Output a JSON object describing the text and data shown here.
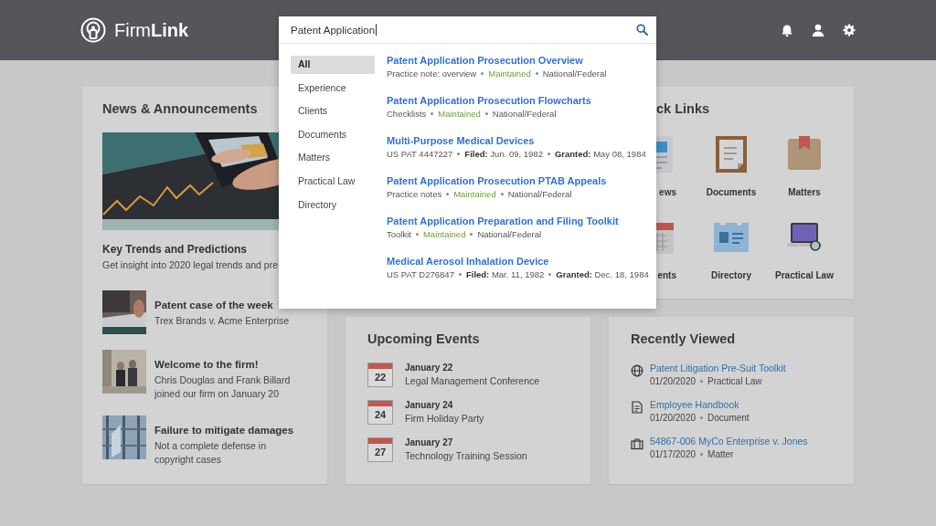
{
  "header": {
    "logo": "Firm**Link**"
  },
  "search": {
    "value": "Patent Application",
    "categories": [
      {
        "label": "All",
        "selected": true
      },
      {
        "label": "Experience",
        "selected": false
      },
      {
        "label": "Clients",
        "selected": false
      },
      {
        "label": "Documents",
        "selected": false
      },
      {
        "label": "Matters",
        "selected": false
      },
      {
        "label": "Practical Law",
        "selected": false
      },
      {
        "label": "Directory",
        "selected": false
      }
    ],
    "results": [
      {
        "title": "Patent Application Prosecution Overview",
        "meta": [
          {
            "kind": "text",
            "text": "Practice note: overview"
          },
          {
            "kind": "status",
            "text": "Maintained"
          },
          {
            "kind": "text",
            "text": "National/Federal"
          }
        ]
      },
      {
        "title": "Patent Application Prosecution Flowcharts",
        "meta": [
          {
            "kind": "text",
            "text": "Checklists"
          },
          {
            "kind": "status",
            "text": "Maintained"
          },
          {
            "kind": "text",
            "text": "National/Federal"
          }
        ]
      },
      {
        "title": "Multi-Purpose Medical Devices",
        "meta": [
          {
            "kind": "text",
            "text": "US PAT 4447227"
          },
          {
            "kind": "field",
            "label": "Filed:",
            "text": "Jun. 09, 1982"
          },
          {
            "kind": "field",
            "label": "Granted:",
            "text": "May 08, 1984"
          }
        ]
      },
      {
        "title": "Patent Application Prosecution PTAB Appeals",
        "meta": [
          {
            "kind": "text",
            "text": "Practice notes"
          },
          {
            "kind": "status",
            "text": "Maintained"
          },
          {
            "kind": "text",
            "text": "National/Federal"
          }
        ]
      },
      {
        "title": "Patent Application Preparation and Filing Toolkit",
        "meta": [
          {
            "kind": "text",
            "text": "Toolkit"
          },
          {
            "kind": "status",
            "text": "Maintained"
          },
          {
            "kind": "text",
            "text": "National/Federal"
          }
        ]
      },
      {
        "title": "Medical Aerosol Inhalation Device",
        "meta": [
          {
            "kind": "text",
            "text": "US PAT D276847"
          },
          {
            "kind": "field",
            "label": "Filed:",
            "text": "Mar. 11, 1982"
          },
          {
            "kind": "field",
            "label": "Granted:",
            "text": "Dec. 18, 1984"
          }
        ]
      }
    ]
  },
  "news": {
    "title": "News & Announcements",
    "feature": {
      "title": "Key Trends and Predictions",
      "text": "Get insight into 2020 legal trends and pre"
    },
    "items": [
      {
        "title": "Patent case of the week",
        "text": "Trex Brands v. Acme Enterprise"
      },
      {
        "title": "Welcome to the firm!",
        "text": "Chris Douglas and Frank Billard joined our firm on January 20"
      },
      {
        "title": "Failure to mitigate damages",
        "text": "Not a complete defense in copyright cases"
      }
    ]
  },
  "quick_links": {
    "title": "ck Links",
    "links": [
      {
        "kind": "news",
        "label": "ews"
      },
      {
        "kind": "documents",
        "label": "Documents"
      },
      {
        "kind": "matters",
        "label": "Matters"
      },
      {
        "kind": "events",
        "label": "ents"
      },
      {
        "kind": "directory",
        "label": "Directory"
      },
      {
        "kind": "practical",
        "label": "Practical Law"
      }
    ]
  },
  "events": {
    "title": "Upcoming Events",
    "items": [
      {
        "day": "22",
        "date": "January 22",
        "name": "Legal Management Conference"
      },
      {
        "day": "24",
        "date": "January 24",
        "name": "Firm Holiday Party"
      },
      {
        "day": "27",
        "date": "January 27",
        "name": "Technology Training Session"
      }
    ]
  },
  "recent": {
    "title": "Recently Viewed",
    "items": [
      {
        "kind": "practical",
        "title": "Patent Litigation Pre-Suit Toolkit",
        "date": "01/20/2020",
        "type": "Practical Law"
      },
      {
        "kind": "document",
        "title": "Employee Handbook",
        "date": "01/20/2020",
        "type": "Document"
      },
      {
        "kind": "matter",
        "title": "54867-006 MyCo Enterprise v. Jones",
        "date": "01/17/2020",
        "type": "Matter"
      }
    ]
  }
}
